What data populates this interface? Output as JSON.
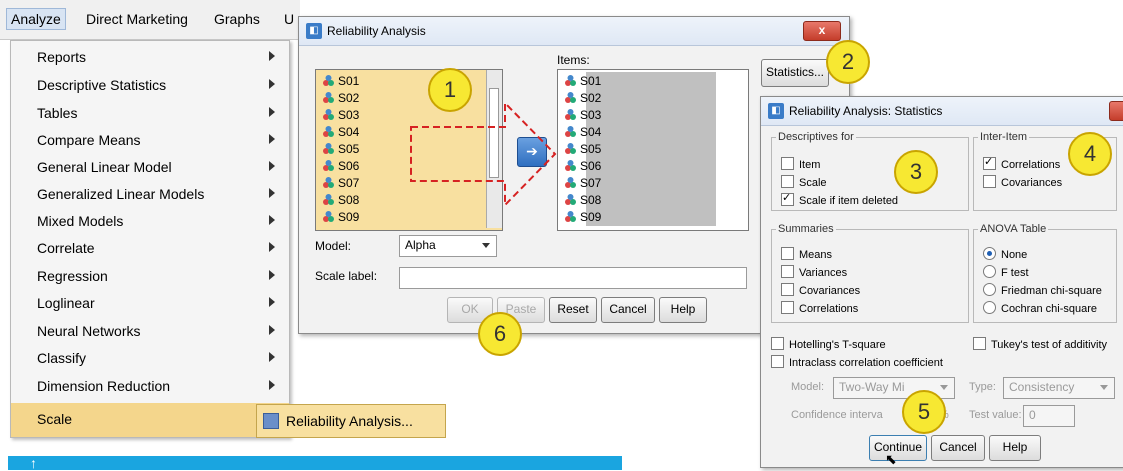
{
  "menubar": {
    "items": [
      "Analyze",
      "Direct Marketing",
      "Graphs",
      "U"
    ]
  },
  "menu": {
    "items": [
      {
        "label": "Reports"
      },
      {
        "label": "Descriptive Statistics"
      },
      {
        "label": "Tables"
      },
      {
        "label": "Compare Means"
      },
      {
        "label": "General Linear Model"
      },
      {
        "label": "Generalized Linear Models"
      },
      {
        "label": "Mixed Models"
      },
      {
        "label": "Correlate"
      },
      {
        "label": "Regression"
      },
      {
        "label": "Loglinear"
      },
      {
        "label": "Neural Networks"
      },
      {
        "label": "Classify"
      },
      {
        "label": "Dimension Reduction"
      },
      {
        "label": "Scale"
      }
    ],
    "selected_index": 13
  },
  "submenu": {
    "item": "Reliability Analysis..."
  },
  "reliability": {
    "title": "Reliability Analysis",
    "close": "x",
    "source_vars": [
      "S01",
      "S02",
      "S03",
      "S04",
      "S05",
      "S06",
      "S07",
      "S08",
      "S09"
    ],
    "items_label": "Items:",
    "items_vars": [
      "S01",
      "S02",
      "S03",
      "S04",
      "S05",
      "S06",
      "S07",
      "S08",
      "S09"
    ],
    "statistics_button": "Statistics...",
    "model_label": "Model:",
    "model_value": "Alpha",
    "scale_label": "Scale label:",
    "scale_value": "",
    "buttons": {
      "ok": "OK",
      "paste": "Paste",
      "reset": "Reset",
      "cancel": "Cancel",
      "help": "Help"
    }
  },
  "stats": {
    "title": "Reliability Analysis: Statistics",
    "descriptives": {
      "legend": "Descriptives for",
      "item": "Item",
      "scale": "Scale",
      "scale_if_deleted": "Scale if item deleted",
      "item_checked": false,
      "scale_checked": false,
      "scale_if_deleted_checked": true
    },
    "inter_item": {
      "legend": "Inter-Item",
      "correlations": "Correlations",
      "covariances": "Covariances",
      "correlations_checked": true,
      "covariances_checked": false
    },
    "summaries": {
      "legend": "Summaries",
      "means": "Means",
      "variances": "Variances",
      "covariances": "Covariances",
      "correlations": "Correlations"
    },
    "anova": {
      "legend": "ANOVA Table",
      "none": "None",
      "f_test": "F test",
      "friedman": "Friedman chi-square",
      "cochran": "Cochran chi-square",
      "selected": "none"
    },
    "hotelling": "Hotelling's T-square",
    "tukey": "Tukey's test of additivity",
    "intraclass": "Intraclass correlation coefficient",
    "model_label": "Model:",
    "model_value": "Two-Way Mi",
    "type_label": "Type:",
    "type_value": "Consistency",
    "ci_label": "Confidence interva",
    "ci_suffix": "%",
    "test_value_label": "Test value:",
    "test_value": "0",
    "buttons": {
      "continue": "Continue",
      "cancel": "Cancel",
      "help": "Help"
    }
  },
  "badges": [
    "1",
    "2",
    "3",
    "4",
    "5",
    "6"
  ],
  "colors": {
    "selection": "#f8e0a0",
    "badge": "#f7e832",
    "arrow": "#d62222",
    "banner": "#1aa5e0"
  }
}
